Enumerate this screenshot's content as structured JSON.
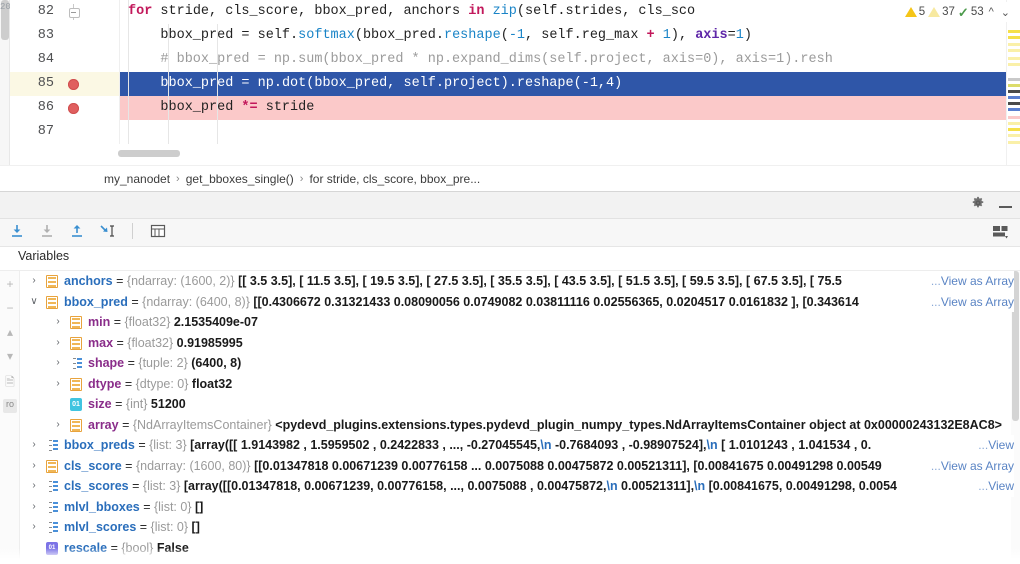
{
  "editor": {
    "left_badge": "20",
    "lines": [
      {
        "number": "82",
        "marker": "fold",
        "state": "normal",
        "segments": [
          {
            "t": "for",
            "c": "kw"
          },
          {
            "t": " stride, cls_score, bbox_pred, anchors ",
            "c": "id"
          },
          {
            "t": "in",
            "c": "kw"
          },
          {
            "t": " ",
            "c": "id"
          },
          {
            "t": "zip",
            "c": "fn"
          },
          {
            "t": "(self.strides, cls_sco",
            "c": "id"
          }
        ]
      },
      {
        "number": "83",
        "marker": "none",
        "state": "normal",
        "segments": [
          {
            "t": "    bbox_pred = self.",
            "c": "id"
          },
          {
            "t": "softmax",
            "c": "fn"
          },
          {
            "t": "(bbox_pred.",
            "c": "id"
          },
          {
            "t": "reshape",
            "c": "fn"
          },
          {
            "t": "(",
            "c": "punc"
          },
          {
            "t": "-1",
            "c": "num"
          },
          {
            "t": ", self.reg_max ",
            "c": "id"
          },
          {
            "t": "+",
            "c": "kw"
          },
          {
            "t": " ",
            "c": "id"
          },
          {
            "t": "1",
            "c": "num"
          },
          {
            "t": "), ",
            "c": "punc"
          },
          {
            "t": "axis",
            "c": "kwarg"
          },
          {
            "t": "=",
            "c": "punc"
          },
          {
            "t": "1",
            "c": "num"
          },
          {
            "t": ")",
            "c": "punc"
          }
        ]
      },
      {
        "number": "84",
        "marker": "none",
        "state": "normal",
        "segments": [
          {
            "t": "    # bbox_pred = np.sum(bbox_pred * np.expand_dims(self.project, axis=0), axis=1).resh",
            "c": "cmt"
          }
        ]
      },
      {
        "number": "85",
        "marker": "breakpoint",
        "state": "executing",
        "segments": [
          {
            "t": "    bbox_pred = np.",
            "c": "id"
          },
          {
            "t": "dot",
            "c": "fn"
          },
          {
            "t": "(bbox_pred, self.project).",
            "c": "id"
          },
          {
            "t": "reshape",
            "c": "fn"
          },
          {
            "t": "(",
            "c": "punc"
          },
          {
            "t": "-1",
            "c": "num"
          },
          {
            "t": ",",
            "c": "punc"
          },
          {
            "t": "4",
            "c": "num"
          },
          {
            "t": ")",
            "c": "punc"
          }
        ]
      },
      {
        "number": "86",
        "marker": "breakpoint",
        "state": "breakpoint-line",
        "segments": [
          {
            "t": "    bbox_pred ",
            "c": "id"
          },
          {
            "t": "*=",
            "c": "kw"
          },
          {
            "t": " stride",
            "c": "id"
          }
        ]
      },
      {
        "number": "87",
        "marker": "none",
        "state": "normal",
        "segments": []
      }
    ],
    "inspection": {
      "error_count": "5",
      "warning_count": "37",
      "ok_count": "53",
      "up_icon": "chevron-up-icon",
      "down_icon": "chevron-down-icon"
    }
  },
  "breadcrumb": {
    "items": [
      "my_nanodet",
      "get_bboxes_single()",
      "for stride, cls_score, bbox_pre..."
    ],
    "separator": "›"
  },
  "debug_panel": {
    "title_icons": [
      "gear-icon",
      "minimize-icon"
    ],
    "toolbar_icons": [
      "step-over-icon",
      "step-into-icon",
      "step-out-icon",
      "force-step-into-icon",
      "evaluate-expression-icon"
    ],
    "toolbar_right_icon": "layout-settings-icon",
    "tab_label": "Variables",
    "rail_icons": [
      "add-icon",
      "remove-icon",
      "move-up-icon",
      "move-down-icon",
      "copy-icon",
      "paste-icon"
    ]
  },
  "variables": [
    {
      "indent": 0,
      "arrow": "›",
      "icon": "array",
      "name": "anchors",
      "type": "{ndarray: (1600, 2)}",
      "value": "[[  3.5   3.5], [ 11.5   3.5], [ 19.5   3.5], [ 27.5   3.5], [ 35.5   3.5], [ 43.5   3.5], [ 51.5   3.5], [ 59.5   3.5], [ 67.5   3.5], [ 75.5",
      "link": "...View as Array"
    },
    {
      "indent": 0,
      "arrow": "∨",
      "icon": "array",
      "name": "bbox_pred",
      "type": "{ndarray: (6400, 8)}",
      "value": "[[0.4306672  0.31321433 0.08090056 0.0749082  0.03811116 0.02556365,  0.0204517  0.0161832 ], [0.343614",
      "link": "...View as Array"
    },
    {
      "indent": 1,
      "arrow": "›",
      "icon": "array",
      "name": "min",
      "type": "{float32}",
      "value": "2.1535409e-07",
      "link": ""
    },
    {
      "indent": 1,
      "arrow": "›",
      "icon": "array",
      "name": "max",
      "type": "{float32}",
      "value": "0.91985995",
      "link": ""
    },
    {
      "indent": 1,
      "arrow": "›",
      "icon": "list",
      "name": "shape",
      "type": "{tuple: 2}",
      "value": "(6400, 8)",
      "link": ""
    },
    {
      "indent": 1,
      "arrow": "›",
      "icon": "array",
      "name": "dtype",
      "type": "{dtype: 0}",
      "value": "float32",
      "link": ""
    },
    {
      "indent": 1,
      "arrow": "",
      "icon": "int",
      "name": "size",
      "type": "{int}",
      "value": "51200",
      "link": ""
    },
    {
      "indent": 1,
      "arrow": "›",
      "icon": "array",
      "name": "array",
      "type": "{NdArrayItemsContainer}",
      "value": "<pydevd_plugins.extensions.types.pydevd_plugin_numpy_types.NdArrayItemsContainer object at 0x00000243132E8AC8>",
      "link": ""
    },
    {
      "indent": 0,
      "arrow": "›",
      "icon": "list",
      "name": "bbox_preds",
      "type": "{list: 3}",
      "value": "[array([[ 1.9143982 ,  1.5959502 ,  0.2422833 , ..., -0.27045545,\\n        -0.7684093 , -0.98907524],\\n       [ 1.0101243 ,  1.041534  ,  0.",
      "link": "... View"
    },
    {
      "indent": 0,
      "arrow": "›",
      "icon": "array",
      "name": "cls_score",
      "type": "{ndarray: (1600, 80)}",
      "value": "[[0.01347818 0.00671239 0.00776158 ... 0.0075088  0.00475872 0.00521311], [0.00841675 0.00491298 0.00549",
      "link": "...View as Array"
    },
    {
      "indent": 0,
      "arrow": "›",
      "icon": "list",
      "name": "cls_scores",
      "type": "{list: 3}",
      "value": "[array([[0.01347818, 0.00671239, 0.00776158, ..., 0.0075088 , 0.00475872,\\n        0.00521311],\\n       [0.00841675, 0.00491298, 0.0054",
      "link": "... View"
    },
    {
      "indent": 0,
      "arrow": "›",
      "icon": "list",
      "name": "mlvl_bboxes",
      "type": "{list: 0}",
      "value": "[]",
      "link": ""
    },
    {
      "indent": 0,
      "arrow": "›",
      "icon": "list",
      "name": "mlvl_scores",
      "type": "{list: 0}",
      "value": "[]",
      "link": ""
    },
    {
      "indent": 0,
      "arrow": "",
      "icon": "bool",
      "name": "rescale",
      "type": "{bool}",
      "value": "False",
      "link": ""
    }
  ],
  "colors": {
    "selection_blue": "#2f56a8",
    "breakpoint_pink": "#fbc9c9",
    "exec_line_yellow": "#fbf8e4",
    "breakpoint_red": "#e05f5f",
    "link_blue": "#5a84c4",
    "name_blue": "#2a6ebb",
    "sub_name_purple": "#8a2d8a"
  }
}
